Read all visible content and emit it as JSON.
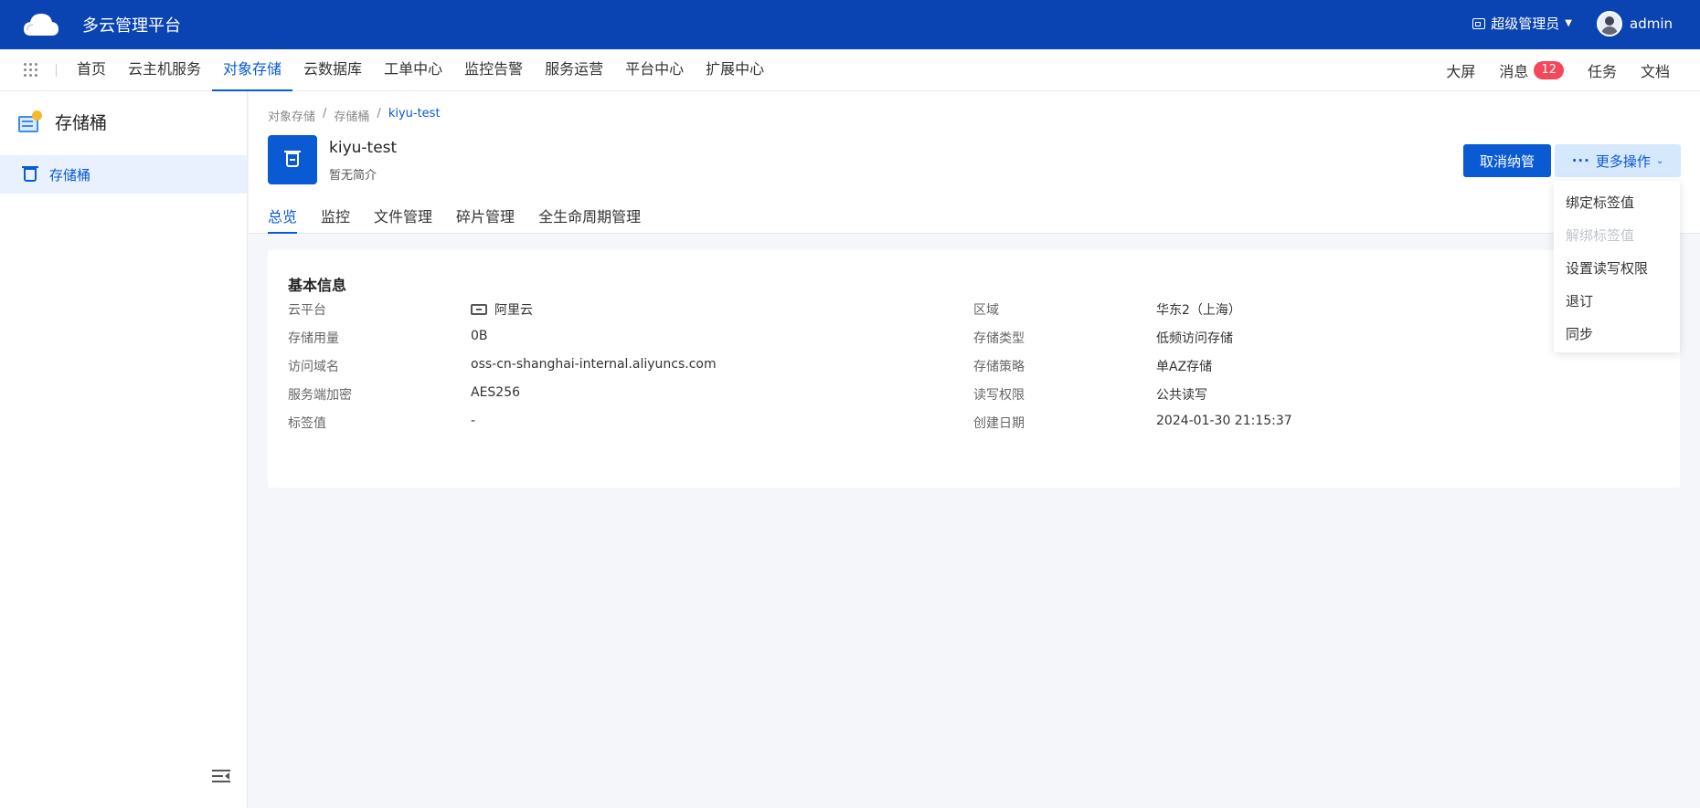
{
  "header": {
    "app_title": "多云管理平台",
    "role": "超级管理员",
    "user": "admin"
  },
  "nav": {
    "items": [
      "首页",
      "云主机服务",
      "对象存储",
      "云数据库",
      "工单中心",
      "监控告警",
      "服务运营",
      "平台中心",
      "扩展中心"
    ],
    "active_index": 2,
    "right": {
      "screen": "大屏",
      "messages": "消息",
      "message_count": "12",
      "tasks": "任务",
      "docs": "文档"
    }
  },
  "sidebar": {
    "title": "存储桶",
    "items": [
      {
        "label": "存储桶",
        "active": true
      }
    ]
  },
  "breadcrumb": [
    "对象存储",
    "存储桶",
    "kiyu-test"
  ],
  "bucket": {
    "name": "kiyu-test",
    "description": "暂无简介"
  },
  "actions": {
    "release": "取消纳管",
    "more": "更多操作"
  },
  "tabs": [
    "总览",
    "监控",
    "文件管理",
    "碎片管理",
    "全生命周期管理"
  ],
  "dropdown": {
    "items": [
      {
        "label": "绑定标签值",
        "disabled": false
      },
      {
        "label": "解绑标签值",
        "disabled": true
      },
      {
        "label": "设置读写权限",
        "disabled": false
      },
      {
        "label": "退订",
        "disabled": false
      },
      {
        "label": "同步",
        "disabled": false
      }
    ]
  },
  "basic_info": {
    "title": "基本信息",
    "left": [
      {
        "label": "云平台",
        "value": "阿里云",
        "icon": "aliyun-icon"
      },
      {
        "label": "存储用量",
        "value": "0B"
      },
      {
        "label": "访问域名",
        "value": "oss-cn-shanghai-internal.aliyuncs.com"
      },
      {
        "label": "服务端加密",
        "value": "AES256"
      },
      {
        "label": "标签值",
        "value": "-"
      }
    ],
    "right": [
      {
        "label": "区域",
        "value": "华东2（上海）"
      },
      {
        "label": "存储类型",
        "value": "低频访问存储"
      },
      {
        "label": "存储策略",
        "value": "单AZ存储"
      },
      {
        "label": "读写权限",
        "value": "公共读写"
      },
      {
        "label": "创建日期",
        "value": "2024-01-30 21:15:37"
      }
    ]
  },
  "colors": {
    "topbar": "#0a44b2",
    "accent": "#0a5ad4",
    "badge": "#f5475a"
  }
}
